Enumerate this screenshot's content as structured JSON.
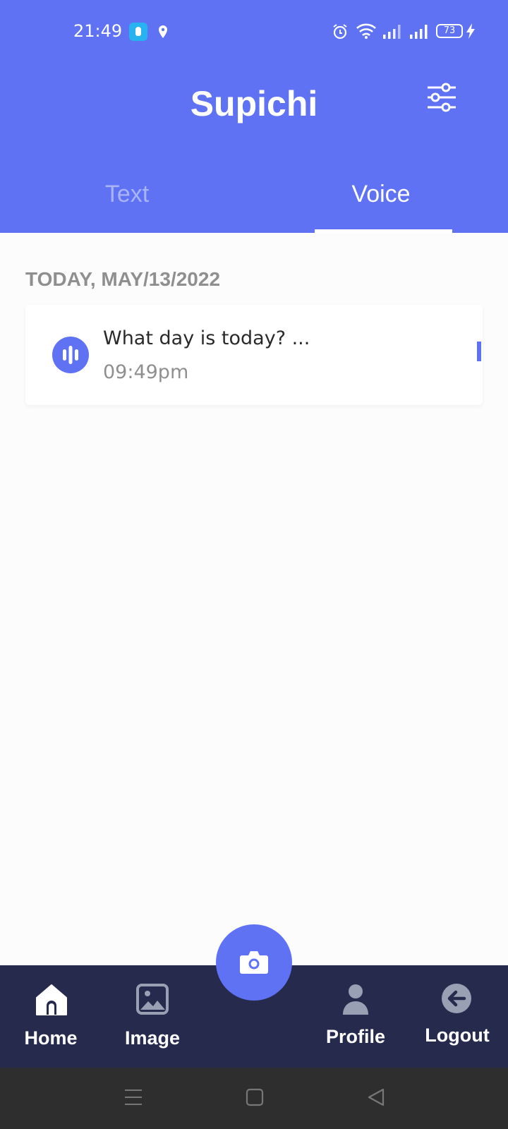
{
  "status_bar": {
    "time": "21:49",
    "battery": "73",
    "icons": [
      "app-badge-icon",
      "location-icon",
      "alarm-icon",
      "wifi-icon",
      "signal-icon",
      "signal-icon",
      "battery-icon",
      "charging-bolt-icon"
    ]
  },
  "header": {
    "title": "Supichi",
    "filter_icon": "sliders-icon"
  },
  "tabs": [
    {
      "label": "Text",
      "active": false
    },
    {
      "label": "Voice",
      "active": true
    }
  ],
  "content": {
    "section_date": "TODAY, MAY/13/2022",
    "items": [
      {
        "icon": "voice-wave-icon",
        "text": "What day is today? ...",
        "time": "09:49pm"
      }
    ]
  },
  "camera_button": {
    "icon": "camera-icon"
  },
  "bottom_nav": [
    {
      "label": "Home",
      "icon": "home-icon"
    },
    {
      "label": "Image",
      "icon": "image-icon"
    },
    {
      "label": "Profile",
      "icon": "user-icon"
    },
    {
      "label": "Logout",
      "icon": "logout-icon"
    }
  ],
  "system_nav": [
    "menu-icon",
    "home-square-icon",
    "back-triangle-icon"
  ],
  "colors": {
    "primary": "#5f72f4",
    "nav_bg": "#262b4d",
    "system_nav_bg": "#2e2e2e",
    "muted_text": "#8f8f8f"
  }
}
